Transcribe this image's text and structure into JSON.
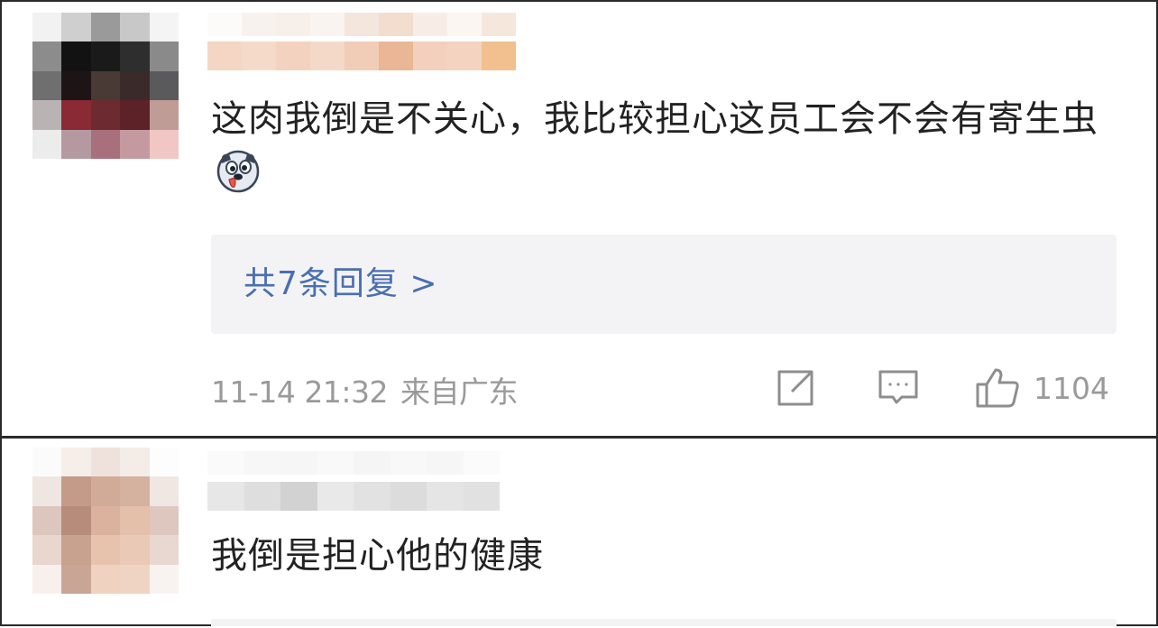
{
  "comments": [
    {
      "text": "这肉我倒是不关心，我比较担心这员工会不会有寄生虫",
      "emoji": "dog-face-emoji",
      "replies_link": "共7条回复 >",
      "timestamp": "11-14 21:32",
      "location": "来自广东",
      "likes": "1104"
    },
    {
      "text": "我倒是担心他的健康"
    }
  ],
  "colors": {
    "text": "#222222",
    "reply_link": "#4a6fb0",
    "meta": "#9a9a9a",
    "reply_bg": "#f3f3f5"
  }
}
